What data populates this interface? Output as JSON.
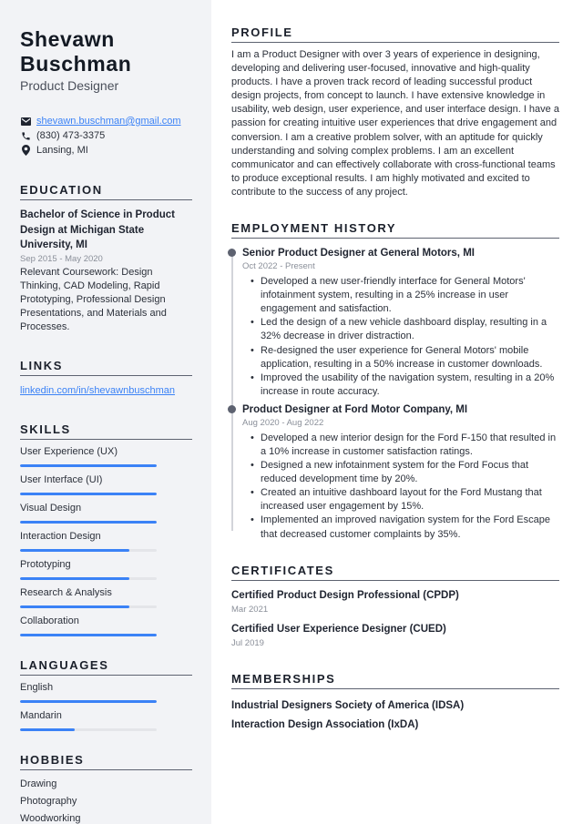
{
  "header": {
    "name_first": "Shevawn",
    "name_last": "Buschman",
    "job_title": "Product Designer"
  },
  "contact": {
    "email": "shevawn.buschman@gmail.com",
    "phone": "(830) 473-3375",
    "location": "Lansing, MI",
    "icons": {
      "email": "envelope-icon",
      "phone": "phone-icon",
      "location": "map-pin-icon"
    }
  },
  "education": {
    "title": "EDUCATION",
    "degree": "Bachelor of Science in Product Design at Michigan State University, MI",
    "dates": "Sep 2015 - May 2020",
    "description": "Relevant Coursework: Design Thinking, CAD Modeling, Rapid Prototyping, Professional Design Presentations, and Materials and Processes."
  },
  "links": {
    "title": "LINKS",
    "items": [
      "linkedin.com/in/shevawnbuschman"
    ]
  },
  "skills": {
    "title": "SKILLS",
    "items": [
      {
        "label": "User Experience (UX)",
        "level": 100
      },
      {
        "label": "User Interface (UI)",
        "level": 100
      },
      {
        "label": "Visual Design",
        "level": 100
      },
      {
        "label": "Interaction Design",
        "level": 80
      },
      {
        "label": "Prototyping",
        "level": 80
      },
      {
        "label": "Research & Analysis",
        "level": 80
      },
      {
        "label": "Collaboration",
        "level": 100
      }
    ]
  },
  "languages": {
    "title": "LANGUAGES",
    "items": [
      {
        "label": "English",
        "level": 100
      },
      {
        "label": "Mandarin",
        "level": 40
      }
    ]
  },
  "hobbies": {
    "title": "HOBBIES",
    "items": [
      "Drawing",
      "Photography",
      "Woodworking"
    ]
  },
  "profile": {
    "title": "PROFILE",
    "text": "I am a Product Designer with over 3 years of experience in designing, developing and delivering user-focused, innovative and high-quality products. I have a proven track record of leading successful product design projects, from concept to launch. I have extensive knowledge in usability, web design, user experience, and user interface design. I have a passion for creating intuitive user experiences that drive engagement and conversion. I am a creative problem solver, with an aptitude for quickly understanding and solving complex problems. I am an excellent communicator and can effectively collaborate with cross-functional teams to produce exceptional results. I am highly motivated and excited to contribute to the success of any project."
  },
  "employment": {
    "title": "EMPLOYMENT HISTORY",
    "jobs": [
      {
        "title": "Senior Product Designer at General Motors, MI",
        "dates": "Oct 2022 - Present",
        "bullets": [
          "Developed a new user-friendly interface for General Motors' infotainment system, resulting in a 25% increase in user engagement and satisfaction.",
          "Led the design of a new vehicle dashboard display, resulting in a 32% decrease in driver distraction.",
          "Re-designed the user experience for General Motors' mobile application, resulting in a 50% increase in customer downloads.",
          "Improved the usability of the navigation system, resulting in a 20% increase in route accuracy."
        ]
      },
      {
        "title": "Product Designer at Ford Motor Company, MI",
        "dates": "Aug 2020 - Aug 2022",
        "bullets": [
          "Developed a new interior design for the Ford F-150 that resulted in a 10% increase in customer satisfaction ratings.",
          "Designed a new infotainment system for the Ford Focus that reduced development time by 20%.",
          "Created an intuitive dashboard layout for the Ford Mustang that increased user engagement by 15%.",
          "Implemented an improved navigation system for the Ford Escape that decreased customer complaints by 35%."
        ]
      }
    ]
  },
  "certificates": {
    "title": "CERTIFICATES",
    "items": [
      {
        "name": "Certified Product Design Professional (CPDP)",
        "date": "Mar 2021"
      },
      {
        "name": "Certified User Experience Designer (CUED)",
        "date": "Jul 2019"
      }
    ]
  },
  "memberships": {
    "title": "MEMBERSHIPS",
    "items": [
      "Industrial Designers Society of America (IDSA)",
      "Interaction Design Association (IxDA)"
    ]
  },
  "colors": {
    "accent": "#3b82f6",
    "sidebar_bg": "#f2f3f6",
    "text": "#1f2430",
    "muted": "#8a8f99"
  }
}
